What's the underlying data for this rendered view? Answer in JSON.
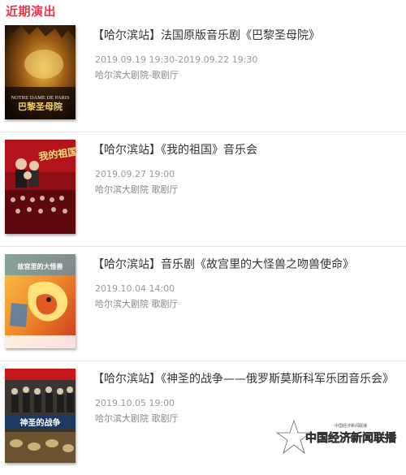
{
  "section": {
    "title": "近期演出"
  },
  "performances": [
    {
      "title": "【哈尔滨站】法国原版音乐剧《巴黎圣母院》",
      "datetime": "2019.09.19 19:30-2019.09.22 19:30",
      "venue": "哈尔滨大剧院-歌剧厅",
      "poster": {
        "heading_en": "NOTRE DAME DE PARIS",
        "heading_cn": "巴黎圣母院",
        "colors": [
          "#1a0e06",
          "#c9902a"
        ]
      }
    },
    {
      "title": "【哈尔滨站】《我的祖国》音乐会",
      "datetime": "2019.09.27 19:00",
      "venue": "哈尔滨大剧院 歌剧厅",
      "poster": {
        "heading_cn": "我的祖国",
        "colors": [
          "#7a0c12",
          "#c8161d"
        ]
      }
    },
    {
      "title": "【哈尔滨站】音乐剧《故宫里的大怪兽之吻兽使命》",
      "datetime": "2019.10.04 14:00",
      "venue": "哈尔滨大剧院 歌剧厅",
      "poster": {
        "heading_cn": "故宫里的大怪兽",
        "colors": [
          "#e8a21c",
          "#d6452a"
        ]
      }
    },
    {
      "title": "【哈尔滨站】《神圣的战争——俄罗斯莫斯科军乐团音乐会》",
      "datetime": "2019.10.05 19:00",
      "venue": "哈尔滨大剧院 歌剧厅",
      "poster": {
        "heading_cn": "神圣的战争",
        "colors": [
          "#2a2a2a",
          "#8c6a3a"
        ]
      }
    }
  ],
  "watermark": {
    "cn": "中国经济新闻联播",
    "small": "中国经济新闻联播"
  },
  "colors": {
    "accent": "#e8344a",
    "title_text": "#333333",
    "meta_text": "#999999",
    "divider": "#e6e6e6"
  }
}
